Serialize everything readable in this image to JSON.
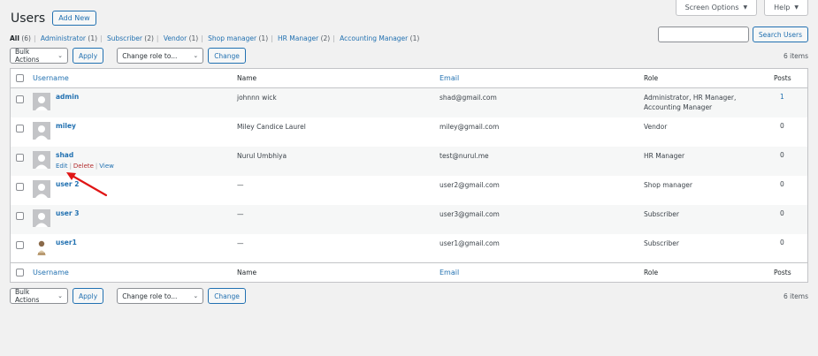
{
  "screen_meta": {
    "screen_options": "Screen Options",
    "help": "Help"
  },
  "header": {
    "title": "Users",
    "add_new": "Add New"
  },
  "filters": [
    {
      "label": "All",
      "count": "(6)",
      "current": true
    },
    {
      "label": "Administrator",
      "count": "(1)"
    },
    {
      "label": "Subscriber",
      "count": "(2)"
    },
    {
      "label": "Vendor",
      "count": "(1)"
    },
    {
      "label": "Shop manager",
      "count": "(1)"
    },
    {
      "label": "HR Manager",
      "count": "(2)"
    },
    {
      "label": "Accounting Manager",
      "count": "(1)"
    }
  ],
  "search": {
    "input_value": "",
    "button": "Search Users"
  },
  "tablenav": {
    "bulk_actions": "Bulk Actions",
    "apply": "Apply",
    "change_role": "Change role to...",
    "change": "Change",
    "items": "6 items"
  },
  "columns": {
    "username": "Username",
    "name": "Name",
    "email": "Email",
    "role": "Role",
    "posts": "Posts"
  },
  "users": [
    {
      "username": "admin",
      "name": "johnnn wick",
      "email": "shad@gmail.com",
      "role_line1": "Administrator, HR Manager,",
      "role_line2": "Accounting Manager",
      "posts": "1"
    },
    {
      "username": "miley",
      "name": "Miley Candice Laurel",
      "email": "miley@gmail.com",
      "role_line1": "Vendor",
      "role_line2": "",
      "posts": "0"
    },
    {
      "username": "shad",
      "name": "Nurul Umbhiya",
      "email": "test@nurul.me",
      "role_line1": "HR Manager",
      "role_line2": "",
      "posts": "0"
    },
    {
      "username": "user 2",
      "name": "—",
      "email": "user2@gmail.com",
      "role_line1": "Shop manager",
      "role_line2": "",
      "posts": "0"
    },
    {
      "username": "user 3",
      "name": "—",
      "email": "user3@gmail.com",
      "role_line1": "Subscriber",
      "role_line2": "",
      "posts": "0"
    },
    {
      "username": "user1",
      "name": "—",
      "email": "user1@gmail.com",
      "role_line1": "Subscriber",
      "role_line2": "",
      "posts": "0"
    }
  ],
  "row_actions": {
    "edit": "Edit",
    "delete": "Delete",
    "view": "View"
  },
  "colors": {
    "link": "#2271b1",
    "delete": "#b32d2e",
    "annotation_arrow": "#e01515"
  }
}
